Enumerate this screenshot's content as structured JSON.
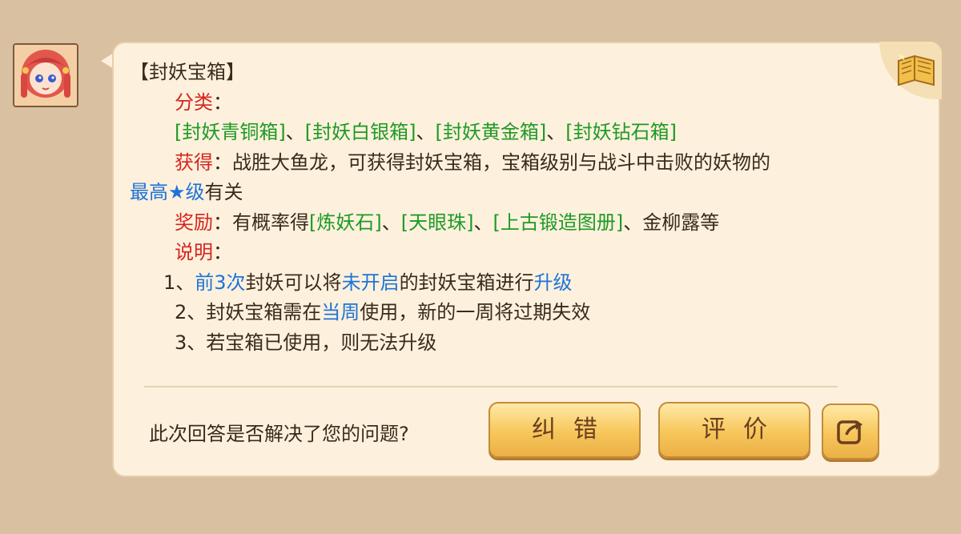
{
  "heading": "【封妖宝箱】",
  "category": {
    "label": "分类",
    "colon": "：",
    "items": [
      "[封妖青铜箱]",
      "[封妖白银箱]",
      "[封妖黄金箱]",
      "[封妖钻石箱]"
    ],
    "separator": "、"
  },
  "obtain": {
    "label": "获得",
    "text1": "：战胜大鱼龙，可获得封妖宝箱，宝箱级别与战斗中击败的妖物的",
    "highlight": "最高★级",
    "text2": "有关"
  },
  "reward": {
    "label": "奖励",
    "text1": "：有概率得",
    "items": [
      "[炼妖石]",
      "[天眼珠]",
      "[上古锻造图册]"
    ],
    "separator": "、",
    "text2": "、金柳露等"
  },
  "notes": {
    "label": "说明",
    "colon": "：",
    "note1": {
      "prefix": "1、",
      "hl1": "前3次",
      "mid1": "封妖可以将",
      "hl2": "未开启",
      "mid2": "的封妖宝箱进行",
      "hl3": "升级"
    },
    "note2": {
      "prefix": "2、封妖宝箱需在",
      "hl": "当周",
      "suffix": "使用，新的一周将过期失效"
    },
    "note3": "3、若宝箱已使用，则无法升级"
  },
  "footer": {
    "question": "此次回答是否解决了您的问题?",
    "correct_label": "纠错",
    "rate_label": "评价"
  },
  "icons": {
    "avatar": "avatar-girl",
    "book": "book-icon",
    "share": "share-icon"
  },
  "colors": {
    "red": "#d6241e",
    "green": "#1e9a24",
    "blue": "#1e73d8"
  }
}
